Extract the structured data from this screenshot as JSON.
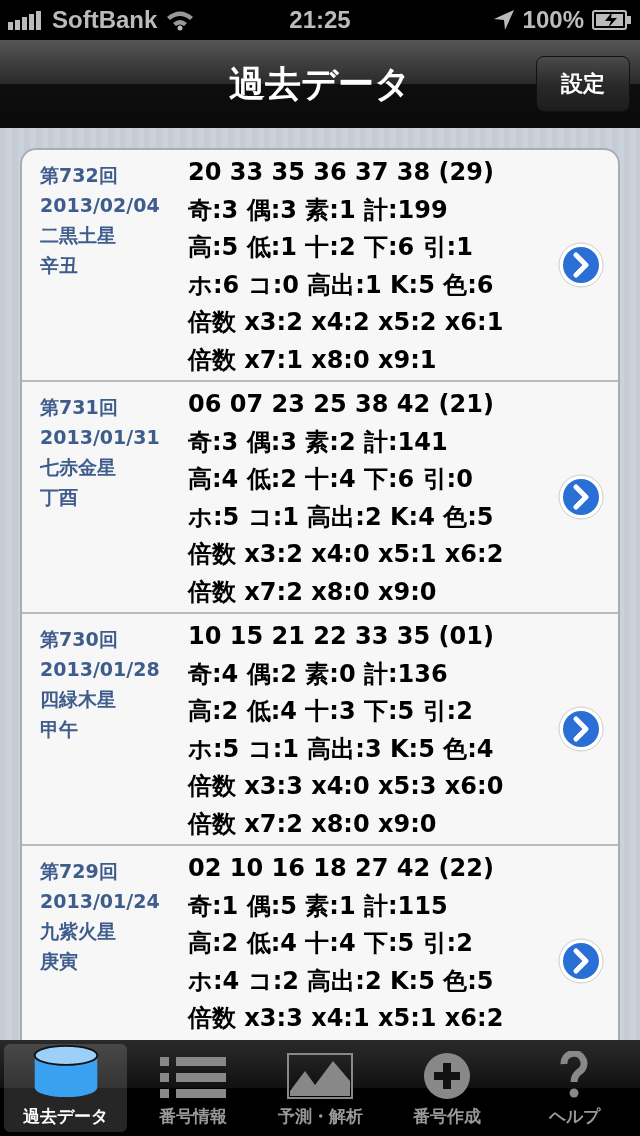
{
  "status_bar": {
    "carrier": "SoftBank",
    "time": "21:25",
    "battery": "100%"
  },
  "nav_bar": {
    "title": "過去データ",
    "button": "設定"
  },
  "draws": [
    {
      "round": "第732回",
      "date": "2013/02/04",
      "star": "二黒土星",
      "zodiac": "辛丑",
      "lines": [
        "20 33 35 36 37 38 (29)",
        "奇:3 偶:3 素:1 計:199",
        "高:5 低:1 十:2 下:6 引:1",
        "ホ:6 コ:0 高出:1 K:5 色:6",
        "倍数 x3:2 x4:2 x5:2 x6:1",
        "倍数 x7:1 x8:0 x9:1"
      ]
    },
    {
      "round": "第731回",
      "date": "2013/01/31",
      "star": "七赤金星",
      "zodiac": "丁酉",
      "lines": [
        "06 07 23 25 38 42 (21)",
        "奇:3 偶:3 素:2 計:141",
        "高:4 低:2 十:4 下:6 引:0",
        "ホ:5 コ:1 高出:2 K:4 色:5",
        "倍数 x3:2 x4:0 x5:1 x6:2",
        "倍数 x7:2 x8:0 x9:0"
      ]
    },
    {
      "round": "第730回",
      "date": "2013/01/28",
      "star": "四緑木星",
      "zodiac": "甲午",
      "lines": [
        "10 15 21 22 33 35 (01)",
        "奇:4 偶:2 素:0 計:136",
        "高:2 低:4 十:3 下:5 引:2",
        "ホ:5 コ:1 高出:3 K:5 色:4",
        "倍数 x3:3 x4:0 x5:3 x6:0",
        "倍数 x7:2 x8:0 x9:0"
      ]
    },
    {
      "round": "第729回",
      "date": "2013/01/24",
      "star": "九紫火星",
      "zodiac": "庚寅",
      "lines": [
        "02 10 16 18 27 42 (22)",
        "奇:1 偶:5 素:1 計:115",
        "高:2 低:4 十:4 下:5 引:2",
        "ホ:4 コ:2 高出:2 K:5 色:5",
        "倍数 x3:3 x4:1 x5:1 x6:2"
      ]
    }
  ],
  "tabs": [
    {
      "label": "過去データ",
      "kind": "database",
      "selected": true
    },
    {
      "label": "番号情報",
      "kind": "list",
      "selected": false
    },
    {
      "label": "予測・解析",
      "kind": "chart",
      "selected": false
    },
    {
      "label": "番号作成",
      "kind": "add",
      "selected": false
    },
    {
      "label": "ヘルプ",
      "kind": "help",
      "selected": false
    }
  ]
}
